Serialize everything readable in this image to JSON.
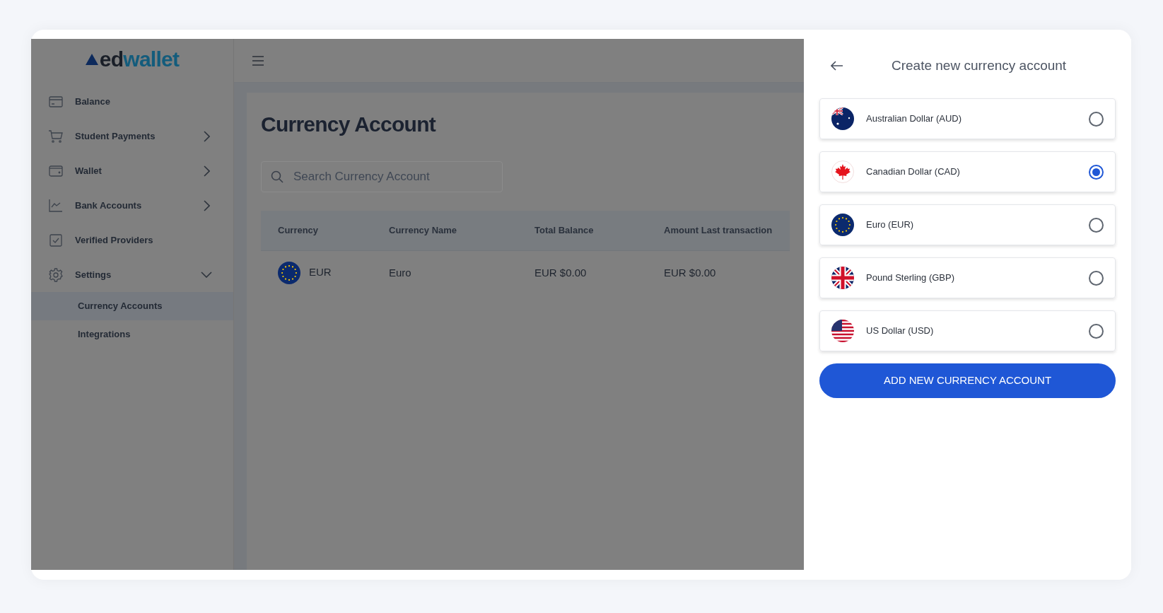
{
  "logo": {
    "prefix": "ed",
    "suffix": "wallet"
  },
  "sidebar": {
    "items": [
      {
        "label": "Balance",
        "kind": "link"
      },
      {
        "label": "Student Payments",
        "kind": "menu",
        "expanded": false
      },
      {
        "label": "Wallet",
        "kind": "menu",
        "expanded": false
      },
      {
        "label": "Bank Accounts",
        "kind": "menu",
        "expanded": false
      },
      {
        "label": "Verified Providers",
        "kind": "link"
      },
      {
        "label": "Settings",
        "kind": "menu",
        "expanded": true,
        "children": [
          {
            "label": "Currency Accounts",
            "selected": true
          },
          {
            "label": "Integrations",
            "selected": false
          }
        ]
      }
    ]
  },
  "page": {
    "title": "Currency Account",
    "search": {
      "placeholder": "Search Currency Account"
    },
    "table": {
      "columns": [
        "Currency",
        "Currency Name",
        "Total Balance",
        "Amount Last transaction"
      ],
      "rows": [
        {
          "currency": "EUR",
          "name": "Euro",
          "total_balance": "EUR $0.00",
          "last_amount": "EUR $0.00"
        }
      ]
    }
  },
  "panel": {
    "title": "Create new currency account",
    "options": [
      {
        "label": "Australian Dollar (AUD)",
        "selected": false
      },
      {
        "label": "Canadian Dollar (CAD)",
        "selected": true
      },
      {
        "label": "Euro (EUR)",
        "selected": false
      },
      {
        "label": "Pound Sterling (GBP)",
        "selected": false
      },
      {
        "label": "US Dollar (USD)",
        "selected": false
      }
    ],
    "button": "ADD NEW CURRENCY ACCOUNT"
  }
}
